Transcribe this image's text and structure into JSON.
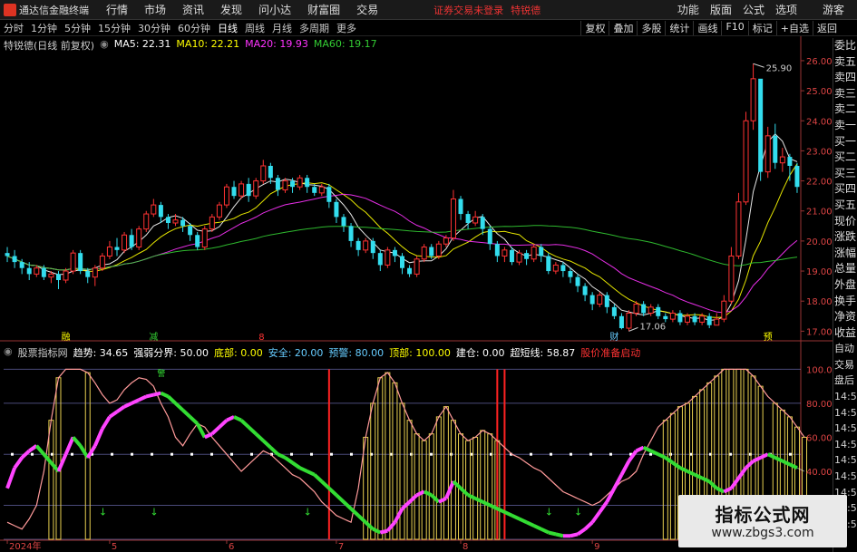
{
  "menubar": {
    "app_title": "通达信金融终端",
    "items": [
      "行情",
      "市场",
      "资讯",
      "发现",
      "问小达",
      "财富圈",
      "交易"
    ],
    "warning_text": "证券交易未登录",
    "stock_name": "特锐德",
    "right_items": [
      "功能",
      "版面",
      "公式",
      "选项"
    ],
    "guest": "游客"
  },
  "periodbar": {
    "items": [
      "分时",
      "1分钟",
      "5分钟",
      "15分钟",
      "30分钟",
      "60分钟",
      "日线",
      "周线",
      "月线",
      "多周期",
      "更多"
    ],
    "active": "日线",
    "right_items": [
      "复权",
      "叠加",
      "多股",
      "统计",
      "画线",
      "F10",
      "标记",
      "+自选",
      "返回"
    ]
  },
  "main_legend": {
    "title": "特锐德(日线 前复权)",
    "ma5": "MA5: 22.31",
    "ma10": "MA10: 22.21",
    "ma20": "MA20: 19.93",
    "ma60": "MA60: 19.17",
    "colors": {
      "ma5": "#ffffff",
      "ma10": "#ffff00",
      "ma20": "#ff33ff",
      "ma60": "#33cc33"
    }
  },
  "sub_legend": {
    "title": "股票指标网",
    "items": [
      {
        "label": "趋势: 34.65",
        "color": "#ffffff"
      },
      {
        "label": "强弱分界: 50.00",
        "color": "#ffffff"
      },
      {
        "label": "底部: 0.00",
        "color": "#ffff00"
      },
      {
        "label": "安全: 20.00",
        "color": "#66ccff"
      },
      {
        "label": "预警: 80.00",
        "color": "#66ccff"
      },
      {
        "label": "顶部: 100.00",
        "color": "#ffff00"
      },
      {
        "label": "建仓: 0.00",
        "color": "#ffffff"
      },
      {
        "label": "超短线: 58.87",
        "color": "#ffffff"
      },
      {
        "label": "股价准备启动",
        "color": "#ff3333"
      }
    ]
  },
  "price_axis": [
    "26.00",
    "25.00",
    "24.00",
    "23.00",
    "22.00",
    "21.00",
    "20.00",
    "19.00",
    "18.00",
    "17.00"
  ],
  "indicator_axis": [
    "100.00",
    "80.00",
    "60.00",
    "40.00"
  ],
  "date_axis": [
    "2024年",
    "5",
    "6",
    "7",
    "8",
    "9"
  ],
  "annotations": {
    "high_label": "25.90",
    "low_label": "17.06",
    "markers": [
      "融",
      "减",
      "8",
      "财",
      "预"
    ],
    "warn_marker": "警"
  },
  "side_labels": [
    "委比",
    "卖五",
    "卖四",
    "卖三",
    "卖二",
    "卖一",
    "买一",
    "买二",
    "买三",
    "买四",
    "买五",
    "现价",
    "涨跌",
    "涨幅",
    "总量",
    "外盘",
    "换手",
    "净资",
    "收益"
  ],
  "time_labels": [
    "自动",
    "交易",
    "盘后",
    "14:56",
    "14:56",
    "14:56",
    "14:56",
    "14:56",
    "14:56",
    "14:56",
    "14:56",
    "14:56"
  ],
  "watermark": {
    "title": "指标公式网",
    "url": "www.zbgs3.com"
  },
  "chart_data": {
    "type": "candlestick",
    "ylim": [
      16.8,
      26.3
    ],
    "candles": [
      [
        19.6,
        19.5,
        19.8,
        19.3
      ],
      [
        19.5,
        19.3,
        19.7,
        19.1
      ],
      [
        19.3,
        19.1,
        19.4,
        18.9
      ],
      [
        19.1,
        18.9,
        19.3,
        18.7
      ],
      [
        18.9,
        19.1,
        19.2,
        18.8
      ],
      [
        19.1,
        18.8,
        19.2,
        18.7
      ],
      [
        18.8,
        18.9,
        19.0,
        18.6
      ],
      [
        18.9,
        18.7,
        19.0,
        18.4
      ],
      [
        18.7,
        19.0,
        19.1,
        18.6
      ],
      [
        19.0,
        19.6,
        19.7,
        18.9
      ],
      [
        19.6,
        19.0,
        19.7,
        18.9
      ],
      [
        19.0,
        18.8,
        19.1,
        18.6
      ],
      [
        18.8,
        19.1,
        19.2,
        18.5
      ],
      [
        19.1,
        19.5,
        19.6,
        19.0
      ],
      [
        19.5,
        19.8,
        20.0,
        19.4
      ],
      [
        19.8,
        19.7,
        20.1,
        19.5
      ],
      [
        19.7,
        20.2,
        20.3,
        19.6
      ],
      [
        20.2,
        19.8,
        20.4,
        19.7
      ],
      [
        19.8,
        20.4,
        20.5,
        19.7
      ],
      [
        20.4,
        20.9,
        21.0,
        20.3
      ],
      [
        20.9,
        21.2,
        21.4,
        20.8
      ],
      [
        21.2,
        20.8,
        21.3,
        20.6
      ],
      [
        20.8,
        20.6,
        20.9,
        20.4
      ],
      [
        20.6,
        20.7,
        20.9,
        20.5
      ],
      [
        20.7,
        20.5,
        20.8,
        20.3
      ],
      [
        20.5,
        20.2,
        20.6,
        20.0
      ],
      [
        20.2,
        19.8,
        20.3,
        19.7
      ],
      [
        19.8,
        20.4,
        20.5,
        19.7
      ],
      [
        20.4,
        20.8,
        20.9,
        20.3
      ],
      [
        20.8,
        21.2,
        21.3,
        20.7
      ],
      [
        21.2,
        21.8,
        21.9,
        21.1
      ],
      [
        21.8,
        21.5,
        22.0,
        21.4
      ],
      [
        21.5,
        21.9,
        22.0,
        21.4
      ],
      [
        21.9,
        21.5,
        22.1,
        21.3
      ],
      [
        21.5,
        22.0,
        22.1,
        21.4
      ],
      [
        22.0,
        22.5,
        22.7,
        21.9
      ],
      [
        22.5,
        22.1,
        22.6,
        21.9
      ],
      [
        22.1,
        21.7,
        22.2,
        21.5
      ],
      [
        21.7,
        22.0,
        22.1,
        21.6
      ],
      [
        22.0,
        21.8,
        22.1,
        21.6
      ],
      [
        21.8,
        22.1,
        22.2,
        21.7
      ],
      [
        22.1,
        21.8,
        22.2,
        21.6
      ],
      [
        21.8,
        21.6,
        21.9,
        21.5
      ],
      [
        21.6,
        21.8,
        21.9,
        21.5
      ],
      [
        21.8,
        21.3,
        21.9,
        21.1
      ],
      [
        21.3,
        20.8,
        21.4,
        20.6
      ],
      [
        20.8,
        20.5,
        20.9,
        20.3
      ],
      [
        20.5,
        20.0,
        20.6,
        19.8
      ],
      [
        20.0,
        19.7,
        20.1,
        19.5
      ],
      [
        19.7,
        20.0,
        20.1,
        19.6
      ],
      [
        20.0,
        19.6,
        20.1,
        19.4
      ],
      [
        19.6,
        19.2,
        19.7,
        19.0
      ],
      [
        19.2,
        19.7,
        19.8,
        19.1
      ],
      [
        19.7,
        19.5,
        19.8,
        19.3
      ],
      [
        19.5,
        19.1,
        19.6,
        18.9
      ],
      [
        19.1,
        18.9,
        19.2,
        18.8
      ],
      [
        18.9,
        19.4,
        19.5,
        18.8
      ],
      [
        19.4,
        19.8,
        19.9,
        19.3
      ],
      [
        19.8,
        19.5,
        19.9,
        19.4
      ],
      [
        19.5,
        19.9,
        20.0,
        19.4
      ],
      [
        19.9,
        20.1,
        20.2,
        19.8
      ],
      [
        20.1,
        21.4,
        21.7,
        20.0
      ],
      [
        21.4,
        20.9,
        21.5,
        20.7
      ],
      [
        20.9,
        20.6,
        21.0,
        20.4
      ],
      [
        20.6,
        20.8,
        21.0,
        20.5
      ],
      [
        20.8,
        20.4,
        20.9,
        20.2
      ],
      [
        20.4,
        19.9,
        20.5,
        19.7
      ],
      [
        19.9,
        19.5,
        20.0,
        19.3
      ],
      [
        19.5,
        19.7,
        19.8,
        19.3
      ],
      [
        19.7,
        19.3,
        19.8,
        19.2
      ],
      [
        19.3,
        19.6,
        19.7,
        19.2
      ],
      [
        19.6,
        19.4,
        19.7,
        19.2
      ],
      [
        19.4,
        19.8,
        19.9,
        19.3
      ],
      [
        19.8,
        19.5,
        19.9,
        19.3
      ],
      [
        19.5,
        19.0,
        19.6,
        18.9
      ],
      [
        19.0,
        19.2,
        19.3,
        18.9
      ],
      [
        19.2,
        19.0,
        19.3,
        18.8
      ],
      [
        19.0,
        18.8,
        19.1,
        18.6
      ],
      [
        18.8,
        18.5,
        18.9,
        18.3
      ],
      [
        18.5,
        18.2,
        18.6,
        18.0
      ],
      [
        18.2,
        17.9,
        18.3,
        17.7
      ],
      [
        17.9,
        18.2,
        18.3,
        17.8
      ],
      [
        18.2,
        17.8,
        18.3,
        17.6
      ],
      [
        17.8,
        17.5,
        17.9,
        17.4
      ],
      [
        17.5,
        17.1,
        17.6,
        17.06
      ],
      [
        17.1,
        17.6,
        17.7,
        17.0
      ],
      [
        17.6,
        17.9,
        18.0,
        17.5
      ],
      [
        17.9,
        17.6,
        18.0,
        17.5
      ],
      [
        17.6,
        17.8,
        17.9,
        17.5
      ],
      [
        17.8,
        17.5,
        17.9,
        17.4
      ],
      [
        17.5,
        17.4,
        17.6,
        17.3
      ],
      [
        17.4,
        17.6,
        17.7,
        17.3
      ],
      [
        17.6,
        17.3,
        17.7,
        17.2
      ],
      [
        17.3,
        17.5,
        17.6,
        17.2
      ],
      [
        17.5,
        17.3,
        17.6,
        17.2
      ],
      [
        17.3,
        17.5,
        17.6,
        17.2
      ],
      [
        17.5,
        17.2,
        17.6,
        17.1
      ],
      [
        17.2,
        17.4,
        17.6,
        17.2
      ],
      [
        17.4,
        18.0,
        18.2,
        17.3
      ],
      [
        18.0,
        19.5,
        19.8,
        17.9
      ],
      [
        19.5,
        21.3,
        21.6,
        19.4
      ],
      [
        21.3,
        24.0,
        24.3,
        21.2
      ],
      [
        24.0,
        25.4,
        25.9,
        23.7
      ],
      [
        25.4,
        22.3,
        24.2,
        22.0
      ],
      [
        22.3,
        23.5,
        23.8,
        22.1
      ],
      [
        23.5,
        22.6,
        23.9,
        22.4
      ],
      [
        22.6,
        22.8,
        23.1,
        22.3
      ],
      [
        22.8,
        22.5,
        22.9,
        22.0
      ],
      [
        22.5,
        21.8,
        22.6,
        21.6
      ]
    ],
    "ma_series": [
      {
        "name": "MA5",
        "color": "#ffffff"
      },
      {
        "name": "MA10",
        "color": "#ffff00"
      },
      {
        "name": "MA20",
        "color": "#ff33ff"
      },
      {
        "name": "MA60",
        "color": "#33cc33"
      }
    ],
    "indicator": {
      "ylim": [
        0,
        105
      ],
      "levels": [
        100,
        80,
        50,
        20,
        0
      ],
      "trend": [
        30,
        42,
        48,
        52,
        55,
        50,
        45,
        40,
        50,
        60,
        55,
        48,
        55,
        65,
        72,
        75,
        78,
        80,
        82,
        84,
        85,
        86,
        84,
        80,
        76,
        72,
        68,
        60,
        62,
        66,
        70,
        72,
        70,
        66,
        62,
        58,
        54,
        50,
        48,
        45,
        42,
        40,
        38,
        34,
        30,
        26,
        22,
        18,
        14,
        10,
        6,
        4,
        5,
        10,
        18,
        22,
        26,
        28,
        26,
        22,
        24,
        34,
        30,
        26,
        24,
        22,
        20,
        18,
        16,
        14,
        12,
        10,
        8,
        6,
        4,
        3,
        2,
        2,
        3,
        6,
        10,
        16,
        22,
        30,
        38,
        46,
        52,
        54,
        52,
        50,
        48,
        45,
        42,
        40,
        38,
        36,
        34,
        30,
        28,
        30,
        36,
        42,
        46,
        48,
        50,
        48,
        46,
        44,
        42,
        40
      ],
      "short_line": [
        10,
        8,
        6,
        12,
        20,
        40,
        70,
        95,
        100,
        100,
        100,
        98,
        92,
        85,
        80,
        82,
        88,
        92,
        95,
        94,
        90,
        80,
        72,
        60,
        55,
        62,
        68,
        66,
        60,
        55,
        50,
        45,
        40,
        44,
        48,
        52,
        50,
        46,
        42,
        38,
        36,
        32,
        28,
        22,
        18,
        14,
        12,
        10,
        30,
        60,
        80,
        95,
        98,
        92,
        80,
        70,
        62,
        58,
        62,
        72,
        78,
        70,
        62,
        58,
        60,
        64,
        62,
        58,
        54,
        50,
        48,
        45,
        42,
        40,
        36,
        32,
        28,
        26,
        24,
        22,
        20,
        22,
        26,
        30,
        34,
        36,
        40,
        50,
        58,
        66,
        70,
        74,
        78,
        80,
        84,
        88,
        92,
        96,
        100,
        100,
        100,
        100,
        96,
        90,
        84,
        80,
        76,
        72,
        66,
        60
      ],
      "ma_white_dots": 50
    }
  }
}
